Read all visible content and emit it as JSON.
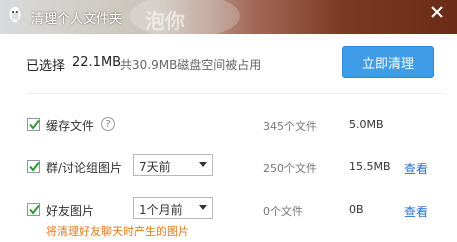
{
  "window": {
    "title": "清理个人文件夹",
    "watermark": "泡你"
  },
  "summary": {
    "selected_label": "已选择",
    "selected_amount": "22.1MB",
    "detail": "共30.9MB磁盘空间被占用",
    "clean_button": "立即清理"
  },
  "items": [
    {
      "label": "缓存文件",
      "count": "345个文件",
      "size": "5.0MB",
      "checked": true,
      "help": "?"
    },
    {
      "label": "群/讨论组图片",
      "dropdown": "7天前",
      "count": "250个文件",
      "size": "15.5MB",
      "action": "查看",
      "checked": true
    },
    {
      "label": "好友图片",
      "dropdown": "1个月前",
      "count": "0个文件",
      "size": "0B",
      "action": "查看",
      "checked": true
    }
  ],
  "warning": "将清理好友聊天时产生的图片",
  "colors": {
    "accent": "#3f9ce6",
    "link": "#2a6fc9",
    "warning": "#e07a1a",
    "check": "#2e9a2e"
  },
  "icons": {
    "app": "penguin-icon",
    "close": "close-icon",
    "help": "help-icon",
    "checkbox": "checkmark-icon"
  }
}
